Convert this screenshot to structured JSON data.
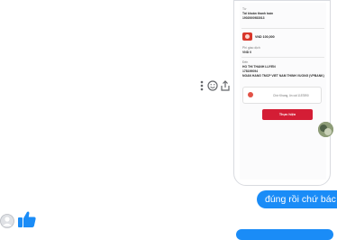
{
  "receipt": {
    "from_label": "Từ",
    "from_account_name": "Tài khoản thanh toán",
    "from_account_number": "1902000983013",
    "amount": "VND 100,000",
    "fee_label": "Phí giao dịch",
    "fee_value": "VND 0",
    "to_label": "Đến",
    "recipient_name": "HO THI THANH LUYEN",
    "recipient_account": "178199094",
    "recipient_bank": "NGAN HANG TMCP VIET NAM THINH VUONG (VPBANK)",
    "message_text": "Chờ Khang, ủn cái 1157890",
    "confirm_button": "Thực hiện"
  },
  "actions": {
    "more_icon": "vertical-ellipsis",
    "react_icon": "smiley-face",
    "share_icon": "share-arrow"
  },
  "messages": [
    {
      "text": "đúng rồi chứ bác ?"
    }
  ],
  "colors": {
    "bubble_blue": "#1a8cf7",
    "like_blue": "#1a8cf7",
    "confirm_red": "#d41d35"
  }
}
